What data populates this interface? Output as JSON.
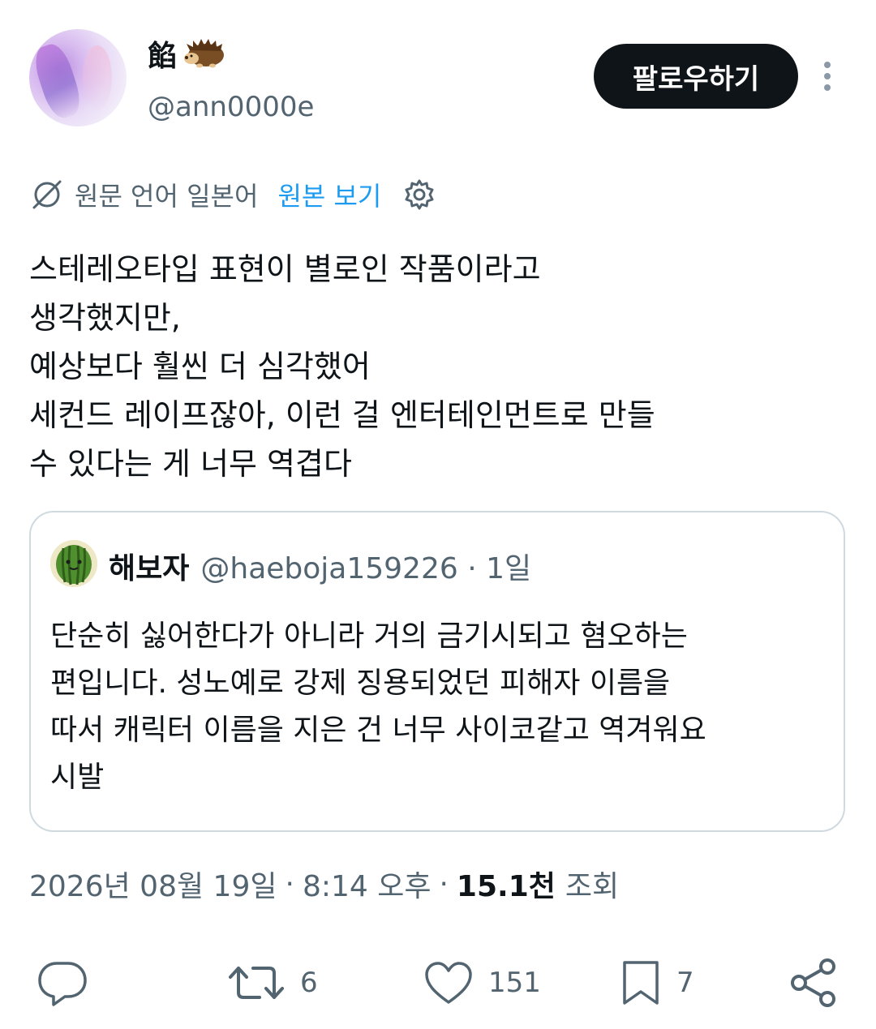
{
  "author": {
    "name": "餡",
    "name_emoji": "hedgehog",
    "handle": "@ann0000e",
    "follow_label": "팔로우하기"
  },
  "translation": {
    "source_label": "원문 언어 일본어",
    "view_original": "원본 보기"
  },
  "tweet": {
    "lines": [
      "스테레오타입 표현이 별로인 작품이라고",
      "생각했지만,",
      "예상보다 훨씬 더 심각했어",
      "세컨드 레이프잖아, 이런 걸 엔터테인먼트로 만들",
      "수 있다는 게 너무 역겹다"
    ]
  },
  "quote": {
    "name": "해보자",
    "handle": "@haeboja159226 · 1일",
    "lines": [
      "단순히 싫어한다가 아니라 거의 금기시되고 혐오하는",
      "편입니다. 성노예로 강제 징용되었던 피해자 이름을",
      "따서 캐릭터 이름을 지은 건 너무 사이코같고 역겨워요",
      "시발"
    ]
  },
  "meta": {
    "date": "2026년 08월 19일",
    "dot": "·",
    "time": "8:14 오후",
    "views_count": "15.1천",
    "views_label": "조회"
  },
  "actions": {
    "reply_icon": "speech-bubble",
    "retweet_icon": "retweet-arrows",
    "retweets": "6",
    "like_icon": "heart",
    "likes": "151",
    "bookmark_icon": "bookmark",
    "bookmarks": "7",
    "share_icon": "share-nodes"
  },
  "colors": {
    "text": "#0f1419",
    "secondary": "#536471",
    "link": "#1d9bf0",
    "border": "#cfd9de",
    "button": "#0f1419"
  }
}
